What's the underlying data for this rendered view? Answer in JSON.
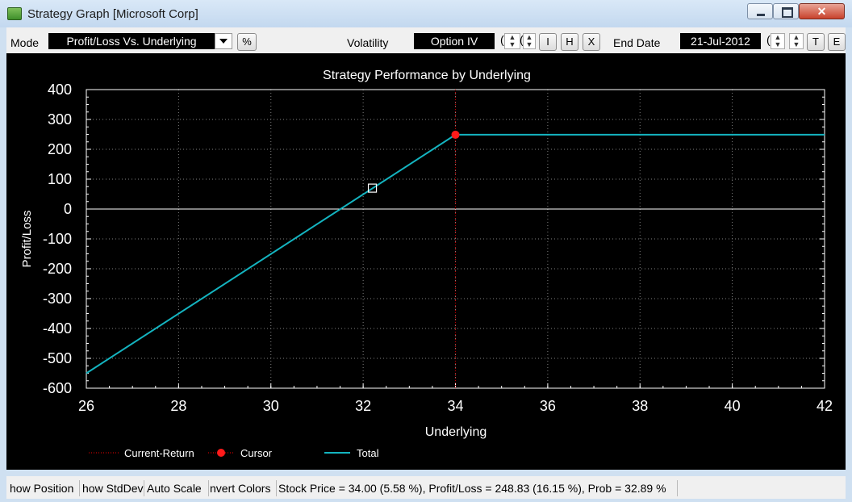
{
  "window": {
    "title": "Strategy Graph [Microsoft Corp]",
    "close_glyph": "✕"
  },
  "toolbar": {
    "mode_label": "Mode",
    "mode_value": "Profit/Loss Vs. Underlying",
    "percent_button": "%",
    "volatility_label": "Volatility",
    "volatility_value": "Option IV",
    "spin_char_a": "(",
    "spin_char_b": "(",
    "spin_char_c": "(",
    "btn_i": "I",
    "btn_h": "H",
    "btn_x": "X",
    "end_date_label": "End Date",
    "end_date_value": "21-Jul-2012",
    "btn_t": "T",
    "btn_e": "E"
  },
  "status": {
    "show_positions": "how Position",
    "show_stddev": "how StdDev",
    "auto_scale": "Auto Scale",
    "invert_colors": "nvert Colors",
    "summary": "Stock Price = 34.00 (5.58 %), Profit/Loss = 248.83 (16.15 %), Prob = 32.89 %"
  },
  "colors": {
    "total": "#14b4c0",
    "cursor": "#ff1a1a",
    "current_return": "#c00000",
    "zero_line": "#ffffff",
    "grid": "#808080"
  },
  "chart_data": {
    "type": "line",
    "title": "Strategy Performance by Underlying",
    "xlabel": "Underlying",
    "ylabel": "Profit/Loss",
    "xlim": [
      26,
      42
    ],
    "ylim": [
      -600,
      400
    ],
    "xticks": [
      26,
      28,
      30,
      32,
      34,
      36,
      38,
      40,
      42
    ],
    "yticks": [
      400,
      300,
      200,
      100,
      0,
      -100,
      -200,
      -300,
      -400,
      -500,
      -600
    ],
    "grid": true,
    "legend_position": "bottom",
    "legend": [
      "Current-Return",
      "Cursor",
      "Total"
    ],
    "series": [
      {
        "name": "Total",
        "x": [
          26,
          34,
          42
        ],
        "y": [
          -550,
          248.83,
          248.83
        ]
      }
    ],
    "current_return_x": 34,
    "cursor": {
      "x": 34,
      "y": 248.83
    },
    "marker_square": {
      "x": 32.2,
      "y": 70
    }
  }
}
